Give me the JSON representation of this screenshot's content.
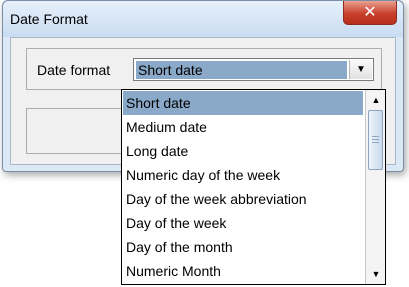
{
  "window": {
    "title": "Date Format",
    "close_glyph": "✕"
  },
  "form": {
    "field_label": "Date format",
    "selected_value": "Short date",
    "dropdown_arrow_icon": "chevron-down-icon"
  },
  "dropdown": {
    "items": [
      "Short date",
      "Medium date",
      "Long date",
      "Numeric day of the week",
      "Day of the week abbreviation",
      "Day of the week",
      "Day of the month",
      "Numeric Month"
    ],
    "selected_index": 0,
    "scroll_up_glyph": "▲",
    "scroll_down_glyph": "▼"
  },
  "colors": {
    "selection": "#8aa8c8",
    "close_button": "#c7402c",
    "titlebar": "#dce8f5"
  }
}
